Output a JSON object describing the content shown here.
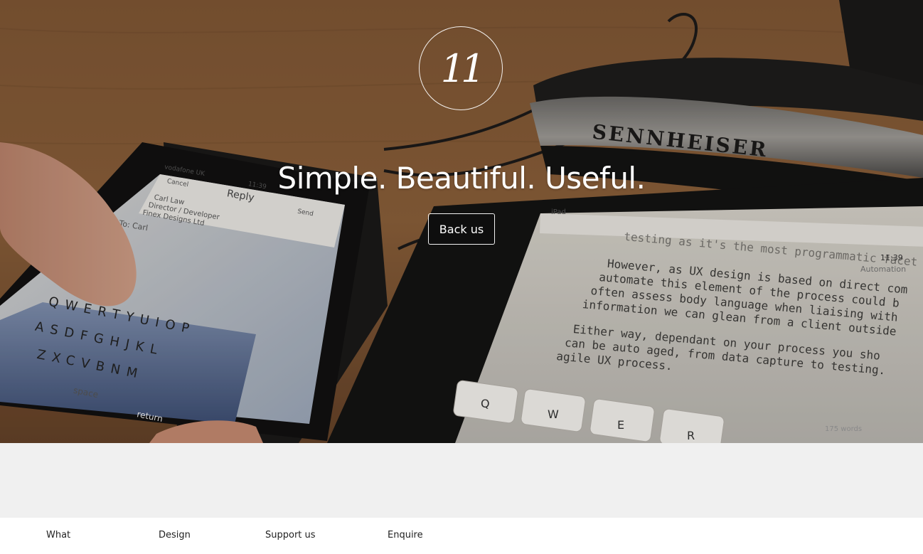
{
  "hero": {
    "logo_text": "11",
    "title": "Simple. Beautiful. Useful.",
    "back_button_label": "Back us",
    "photo": {
      "phone_status": "vodafone UK",
      "phone_time": "11:39",
      "phone_cancel": "Cancel",
      "phone_reply": "Reply",
      "phone_send": "Send",
      "phone_sig_1": "Carl Law",
      "phone_sig_2": "Director / Developer",
      "phone_sig_3": "Finex Designs Ltd",
      "phone_to": "To: Carl",
      "kbd_row1": "QWERTYUIOP",
      "kbd_row2": "ASDFGHJKL",
      "kbd_row3": "ZXCVBNM",
      "kbd_space": "space",
      "kbd_return": "return",
      "headphone_brand": "SENNHEISER",
      "tablet_status": "iPad",
      "tablet_time": "11:39",
      "tablet_heading": "Automation",
      "tablet_top_line": "testing as it's the most programmatic facet",
      "tablet_para1": [
        "However, as UX design is based on direct com",
        "automate this element of the process could b",
        "often assess body language when liaising with",
        "information we can glean from a client outside"
      ],
      "tablet_para2": [
        "Either way, dependant on your process you sho",
        "can be auto aged, from data capture to testing.",
        "agile UX process."
      ],
      "tablet_footer": "175 words",
      "tablet_keys": [
        "Q",
        "W",
        "E",
        "R"
      ]
    }
  },
  "footer_nav": {
    "items": [
      "What",
      "Design",
      "Support us",
      "Enquire"
    ]
  },
  "colors": {
    "band": "#f0f0f0",
    "text": "#222222",
    "hero_text": "#ffffff"
  }
}
